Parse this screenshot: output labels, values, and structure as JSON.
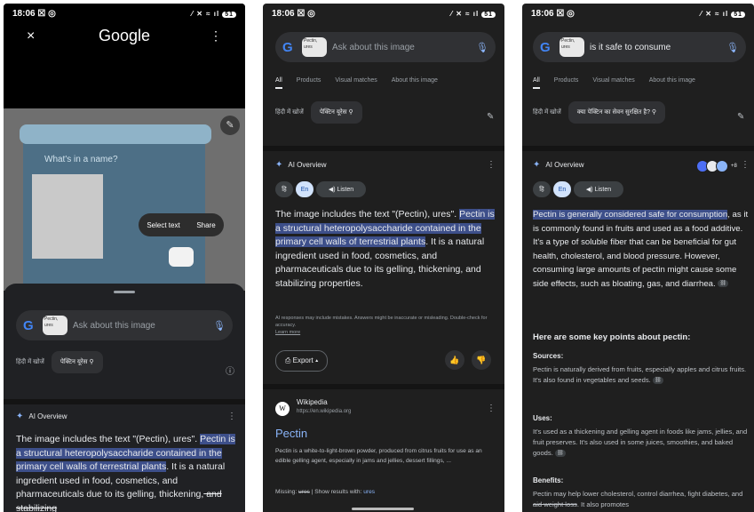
{
  "status": {
    "time": "18:06",
    "left_icons": "☒ ◎",
    "right_icons": "⁄ ✕ ≈ ıl",
    "battery": "51"
  },
  "phone1": {
    "close": "×",
    "title": "Google",
    "menu": "⋮",
    "tub_text": "What's in a name?",
    "popup": {
      "select": "Select text",
      "share": "Share"
    },
    "search": {
      "thumb": "Pectin, ures",
      "placeholder": "Ask about this image"
    },
    "hindi": {
      "label": "हिंदी में खोजें",
      "chip": "पेक्टिन यूरेस"
    },
    "ai": {
      "title": "AI Overview"
    },
    "text": {
      "p1": "The image includes the text \"(Pectin), ures\".",
      "hl": "Pectin is a structural heteropolysaccharide contained in the primary cell walls of terrestrial plants",
      "p2": ". It is a natural ingredient used in food, cosmetics, and pharmaceuticals due to its gelling, thickening,",
      "strike": " and stabilizing"
    }
  },
  "phone2": {
    "search": {
      "thumb": "Pectin, ures",
      "placeholder": "Ask about this image"
    },
    "tabs": [
      "All",
      "Products",
      "Visual matches",
      "About this image"
    ],
    "hindi": {
      "label": "हिंदी में खोजें",
      "chip": "पेक्टिन यूरेस"
    },
    "ai": {
      "title": "AI Overview"
    },
    "toggles": {
      "hi": "हि",
      "en": "En",
      "listen": "◀) Listen"
    },
    "text": {
      "p1": "The image includes the text \"(Pectin), ures\".",
      "hl": "Pectin is a structural heteropolysaccharide contained in the primary cell walls of terrestrial plants",
      "p2": ". It is a natural ingredient used in food, cosmetics, and pharmaceuticals due to its gelling, thickening, and stabilizing properties."
    },
    "disclaimer": "AI responses may include mistakes. Answers might be inaccurate or misleading. Double-check for accuracy.",
    "learn_more": "Learn more",
    "export": "⎙ Export ▴",
    "wiki": {
      "icon": "W",
      "name": "Wikipedia",
      "url": "https://en.wikipedia.org",
      "title": "Pectin",
      "snippet": "Pectin is a white-to-light-brown powder, produced from citrus fruits for use as an edible gelling agent, especially in jams and jellies, dessert fillings, ...",
      "missing_label": "Missing:",
      "missing_word": "ures",
      "show_with": "| Show results with:",
      "show_word": "ures"
    }
  },
  "phone3": {
    "search": {
      "query": "is it safe to consume"
    },
    "tabs": [
      "All",
      "Products",
      "Visual matches",
      "About this image"
    ],
    "hindi": {
      "label": "हिंदी में खोजें",
      "chip": "क्या पेक्टिन का सेवन सुरक्षित है?"
    },
    "ai": {
      "title": "AI Overview",
      "more": "+8"
    },
    "toggles": {
      "hi": "हि",
      "en": "En",
      "listen": "◀) Listen"
    },
    "text": {
      "hl": "Pectin is generally considered safe for consumption",
      "p1": ", as it is commonly found in fruits and used as a food additive. It's a type of soluble fiber that can be beneficial for gut health, cholesterol, and blood pressure. However, consuming large amounts of pectin might cause some side effects, such as bloating, gas, and diarrhea."
    },
    "key_heading": "Here are some key points about pectin:",
    "sources": {
      "h": "Sources:",
      "t": "Pectin is naturally derived from fruits, especially apples and citrus fruits. It's also found in vegetables and seeds."
    },
    "uses": {
      "h": "Uses:",
      "t": "It's used as a thickening and gelling agent in foods like jams, jellies, and fruit preserves. It's also used in some juices, smoothies, and baked goods."
    },
    "benefits": {
      "h": "Benefits:",
      "t": "Pectin may help lower cholesterol, control diarrhea, fight diabetes, and",
      "strike": " aid weight loss",
      "t2": ". It also promotes"
    }
  }
}
